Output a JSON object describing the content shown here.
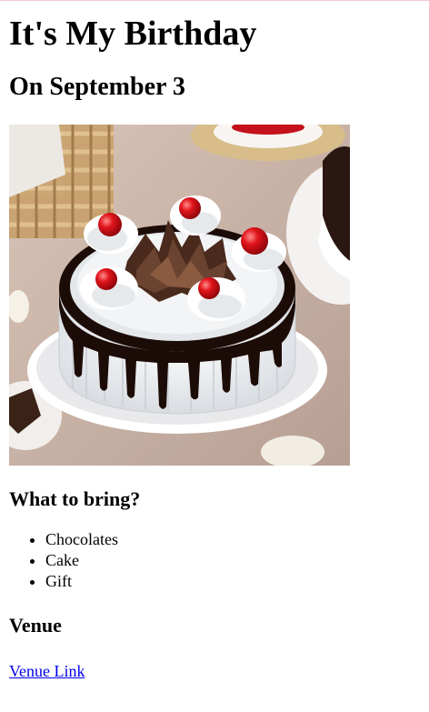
{
  "heading": "It's My Birthday",
  "subheading": "On September 3",
  "image": {
    "subject": "chocolate-drip-cake-photo"
  },
  "bring": {
    "title": "What to bring?",
    "items": [
      "Chocolates",
      "Cake",
      "Gift"
    ]
  },
  "venue": {
    "title": "Venue",
    "link_label": "Venue Link"
  },
  "colors": {
    "link": "#0000ee",
    "text": "#000000",
    "background": "#ffffff"
  }
}
